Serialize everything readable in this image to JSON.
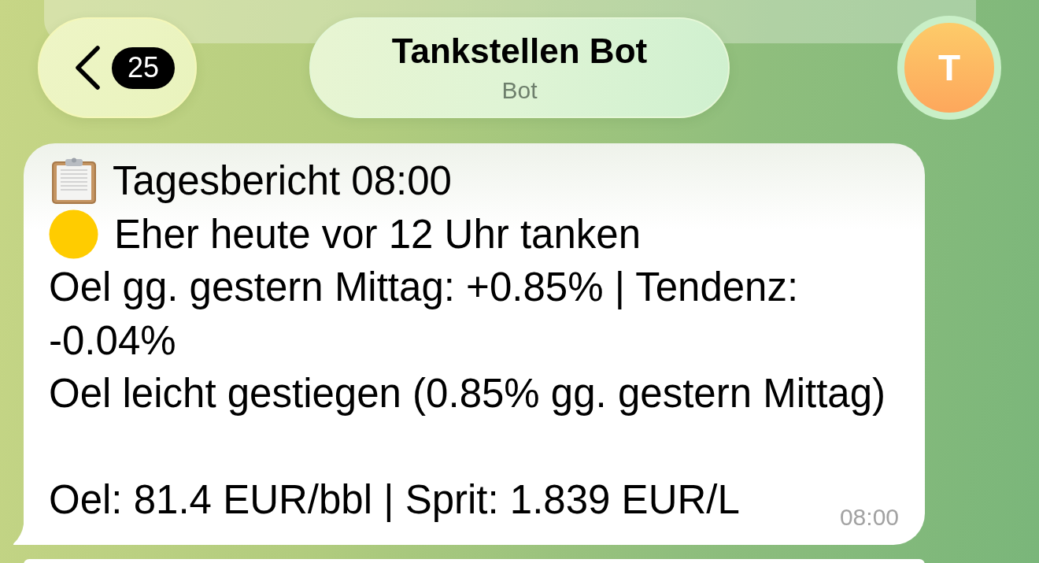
{
  "header": {
    "back_button": {
      "badge": "25"
    },
    "title": "Tankstellen Bot",
    "subtitle": "Bot",
    "avatar": {
      "initial": "T"
    }
  },
  "message": {
    "lines": [
      {
        "kind": "clipboard",
        "text": "Tagesbericht 08:00"
      },
      {
        "kind": "dot",
        "color": "#ffcc00",
        "text": "Eher heute vor 12 Uhr tanken"
      },
      {
        "kind": "plain",
        "text": "Oel gg. gestern Mittag: +0.85% | Tendenz: -0.04%"
      },
      {
        "kind": "plain",
        "text": "Oel leicht gestiegen (0.85% gg. gestern Mittag)"
      },
      {
        "kind": "spaced",
        "text": "Oel: 81.4 EUR/bbl | Sprit: 1.839 EUR/L"
      }
    ],
    "time": "08:00"
  }
}
